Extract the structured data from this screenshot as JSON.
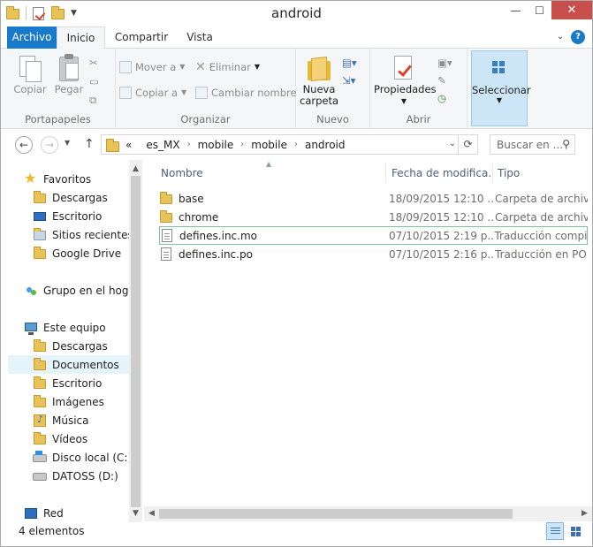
{
  "window": {
    "title": "android",
    "controls": {
      "minimize": "—",
      "maximize": "☐",
      "close": "✕"
    }
  },
  "ribbon_tabs": [
    {
      "label": "Archivo"
    },
    {
      "label": "Inicio"
    },
    {
      "label": "Compartir"
    },
    {
      "label": "Vista"
    }
  ],
  "ribbon": {
    "portapapeles": {
      "group_label": "Portapapeles",
      "copy": "Copiar",
      "paste": "Pegar"
    },
    "organizar": {
      "group_label": "Organizar",
      "move_to": "Mover a",
      "copy_to": "Copiar a",
      "delete": "Eliminar",
      "rename": "Cambiar nombre"
    },
    "nuevo": {
      "group_label": "Nuevo",
      "new_folder_line1": "Nueva",
      "new_folder_line2": "carpeta"
    },
    "abrir": {
      "group_label": "Abrir",
      "properties": "Propiedades"
    },
    "seleccionar": {
      "label": "Seleccionar"
    }
  },
  "address": {
    "overflow": "«",
    "crumbs": [
      "es_MX",
      "mobile",
      "mobile",
      "android"
    ]
  },
  "search": {
    "placeholder": "Buscar en ..."
  },
  "nav_pane": {
    "favorites": {
      "label": "Favoritos",
      "items": [
        "Descargas",
        "Escritorio",
        "Sitios recientes",
        "Google Drive"
      ]
    },
    "homegroup": {
      "label": "Grupo en el hogar"
    },
    "this_pc": {
      "label": "Este equipo",
      "items": [
        "Descargas",
        "Documentos",
        "Escritorio",
        "Imágenes",
        "Música",
        "Vídeos",
        "Disco local (C:)",
        "DATOSS (D:)"
      ]
    },
    "network": {
      "label": "Red"
    }
  },
  "columns": {
    "name": "Nombre",
    "date": "Fecha de modifica...",
    "type": "Tipo"
  },
  "files": [
    {
      "name": "base",
      "date": "18/09/2015 12:10 ...",
      "type": "Carpeta de archivos",
      "icon": "folder-icon"
    },
    {
      "name": "chrome",
      "date": "18/09/2015 12:10 ...",
      "type": "Carpeta de archivos",
      "icon": "folder-icon"
    },
    {
      "name": "defines.inc.mo",
      "date": "07/10/2015 2:19 p....",
      "type": "Traducción compi...",
      "icon": "file-icon"
    },
    {
      "name": "defines.inc.po",
      "date": "07/10/2015 2:16 p....",
      "type": "Traducción en PO",
      "icon": "file-icon"
    }
  ],
  "status": {
    "item_count": "4 elementos"
  },
  "colors": {
    "accent": "#1979ca",
    "selection": "#cde6f7",
    "close": "#c7504d"
  }
}
